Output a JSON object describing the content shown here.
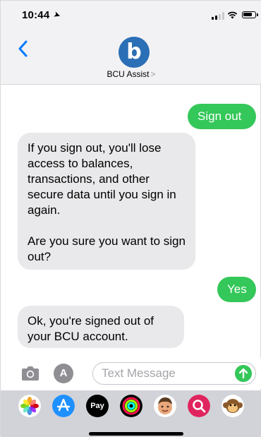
{
  "status": {
    "time": "10:44",
    "location_icon": "location-arrow-icon",
    "icons": [
      "cellular-signal-icon",
      "wifi-icon",
      "battery-icon"
    ]
  },
  "header": {
    "back_icon": "chevron-left-icon",
    "avatar_letter": "b",
    "contact_name": "BCU Assist",
    "contact_chevron": ">"
  },
  "messages": [
    {
      "direction": "outgoing",
      "text": "Sign out"
    },
    {
      "direction": "incoming",
      "paragraphs": [
        "If you sign out, you'll lose access to balances, transactions, and other secure data until you sign in again.",
        "Are you sure you want to sign out?"
      ]
    },
    {
      "direction": "outgoing",
      "text": "Yes"
    },
    {
      "direction": "incoming",
      "paragraphs": [
        "Ok, you're signed out of your BCU account."
      ]
    }
  ],
  "compose": {
    "placeholder": "Text Message",
    "value": "",
    "camera_icon": "camera-icon",
    "apps_icon": "app-store-icon",
    "send_icon": "send-arrow-icon"
  },
  "app_drawer": {
    "apps": [
      {
        "icon": "photos-icon"
      },
      {
        "icon": "app-store-icon"
      },
      {
        "icon": "apple-pay-icon",
        "label": "Pay"
      },
      {
        "icon": "activity-icon"
      },
      {
        "icon": "memoji-icon"
      },
      {
        "icon": "search-images-icon"
      },
      {
        "icon": "monkey-animoji-icon"
      }
    ]
  },
  "colors": {
    "outgoing_bubble": "#34c759",
    "incoming_bubble": "#e9e9eb",
    "accent_blue": "#007aff",
    "avatar": "#2b6fb6"
  }
}
